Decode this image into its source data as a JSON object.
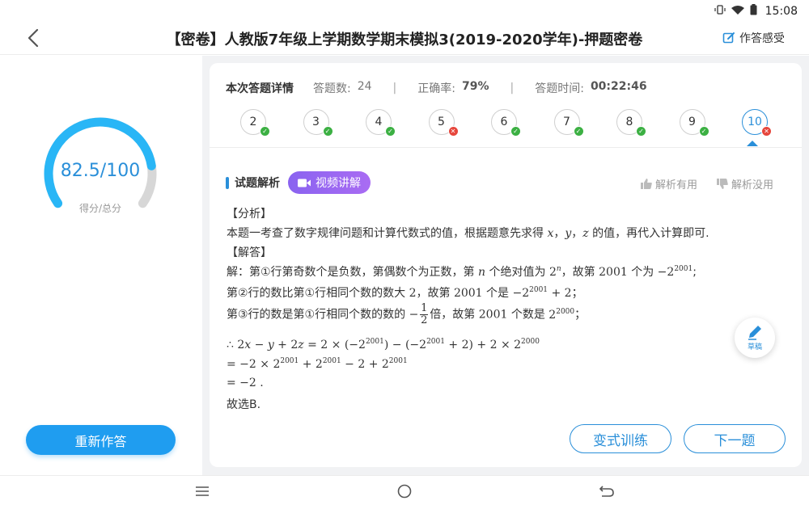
{
  "status": {
    "time": "15:08"
  },
  "header": {
    "title": "【密卷】人教版7年级上学期数学期末模拟3(2019-2020学年)-押题密卷",
    "feel_label": "作答感受"
  },
  "score": {
    "text": "82.5/100",
    "label": "得分/总分",
    "ratio": 0.825,
    "arc_color": "#29b6f6"
  },
  "redo_label": "重新作答",
  "summary": {
    "title": "本次答题详情",
    "count_label": "答题数:",
    "count_value": "24",
    "accuracy_label": "正确率:",
    "accuracy_value": "79%",
    "time_label": "答题时间:",
    "time_value": "00:22:46"
  },
  "questions": [
    {
      "num": "2",
      "status": "correct"
    },
    {
      "num": "3",
      "status": "correct"
    },
    {
      "num": "4",
      "status": "correct"
    },
    {
      "num": "5",
      "status": "wrong"
    },
    {
      "num": "6",
      "status": "correct"
    },
    {
      "num": "7",
      "status": "correct"
    },
    {
      "num": "8",
      "status": "correct"
    },
    {
      "num": "9",
      "status": "correct"
    },
    {
      "num": "10",
      "status": "wrong",
      "active": true
    }
  ],
  "analysis": {
    "title": "试题解析",
    "video_label": "视频讲解",
    "useful_label": "解析有用",
    "useless_label": "解析没用",
    "sec_analysis": "【分析】",
    "analysis_text": "本题一考查了数字规律问题和计算代数式的值，根据题意先求得",
    "analysis_text2": "的值，再代入计算即可.",
    "sec_answer": "【解答】",
    "l1a": "解：第①行第奇数个是负数，第偶数个为正数，第",
    "l1b": "个绝对值为",
    "l1c": "，故第",
    "l1d": "个为",
    "l2a": "第②行的数比第①行相同个数的数大",
    "l2b": "，故第",
    "l2c": "个是",
    "l3a": "第③行的数是第①行相同个数的数的",
    "l3b": "倍，故第",
    "l3c": "个数是",
    "conclusion": "故选B."
  },
  "buttons": {
    "variant": "变式训练",
    "next": "下一题",
    "draft": "草稿"
  }
}
